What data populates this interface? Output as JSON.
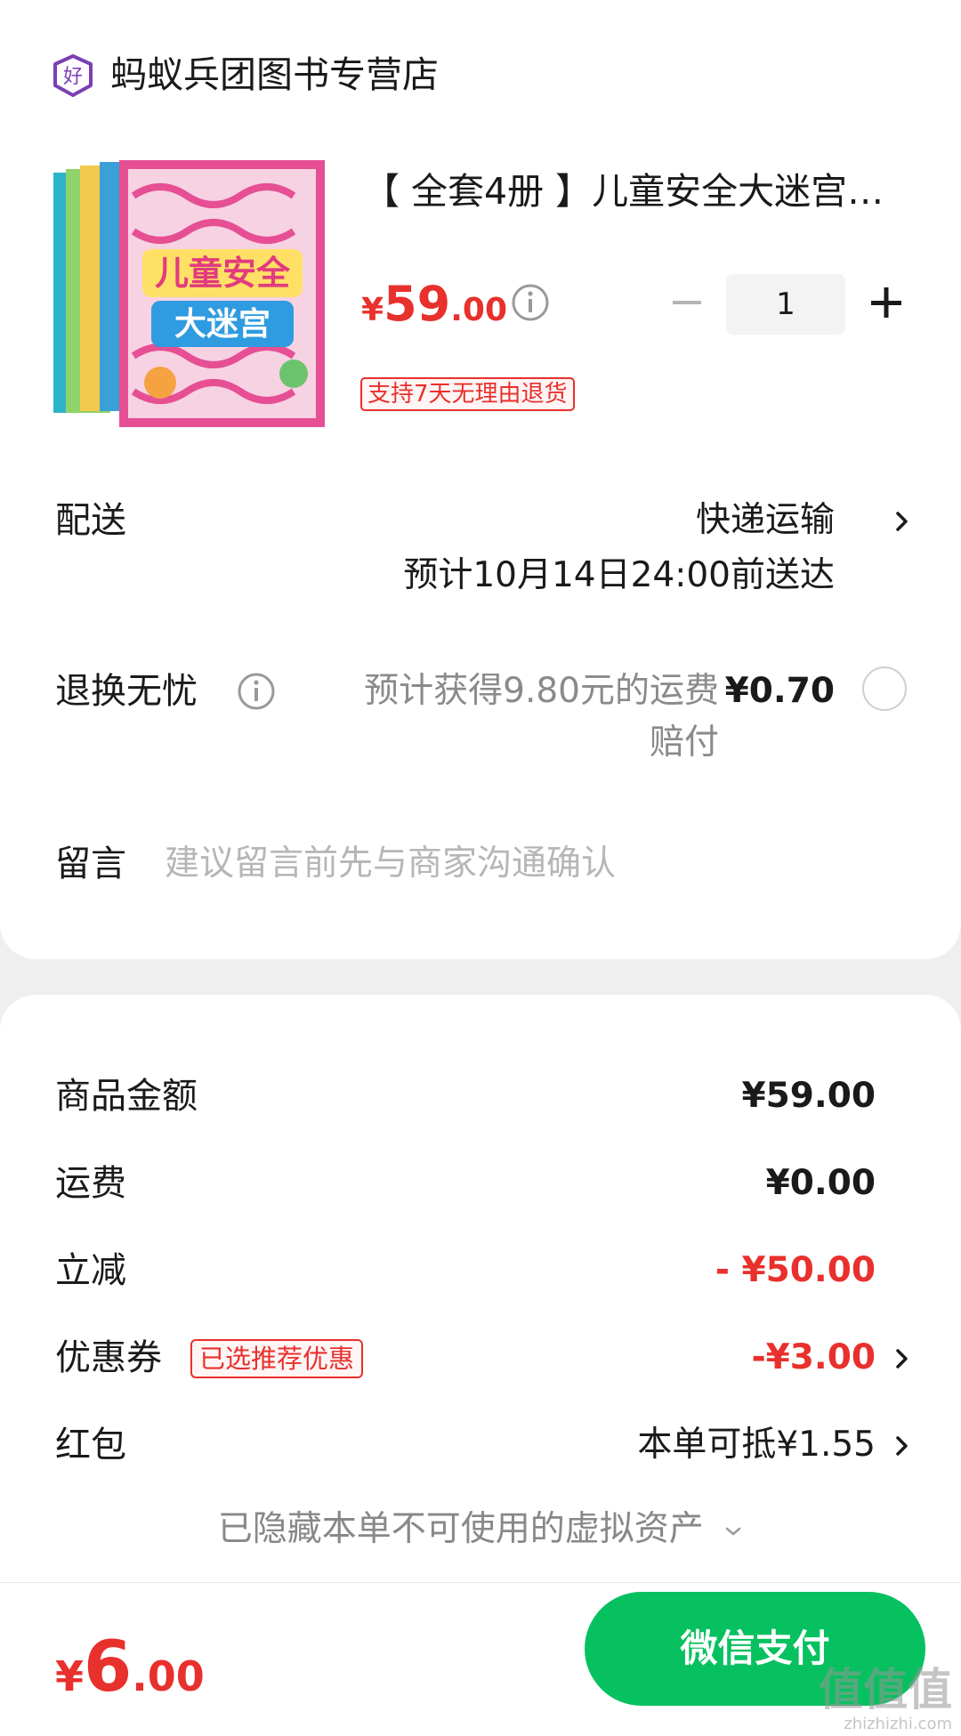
{
  "store": {
    "icon": "store-badge-icon",
    "badge_char": "好",
    "name": "蚂蚁兵团图书专营店"
  },
  "product": {
    "title": "【 全套4册 】儿童安全大迷宫…",
    "cover_text_line1": "儿童安全",
    "cover_text_line2": "大迷宫",
    "price_currency": "¥",
    "price_int": "59",
    "price_dec": ".00",
    "quantity": "1",
    "return_tag": "支持7天无理由退货"
  },
  "delivery": {
    "label": "配送",
    "method": "快递运输",
    "eta": "预计10月14日24:00前送达"
  },
  "return_insurance": {
    "label": "退换无忧",
    "desc_line1": "预计获得9.80元的运费",
    "desc_line2": "赔付",
    "price": "¥0.70"
  },
  "message": {
    "label": "留言",
    "placeholder": "建议留言前先与商家沟通确认"
  },
  "summary": {
    "goods_label": "商品金额",
    "goods_value": "¥59.00",
    "shipping_label": "运费",
    "shipping_value": "¥0.00",
    "discount_label": "立减",
    "discount_value": "- ¥50.00",
    "coupon_label": "优惠券",
    "coupon_tag": "已选推荐优惠",
    "coupon_value": "-¥3.00",
    "redpacket_label": "红包",
    "redpacket_value": "本单可抵¥1.55",
    "hidden_assets": "已隐藏本单不可使用的虚拟资产"
  },
  "footer": {
    "total_currency": "¥",
    "total_int": "6",
    "total_dec": ".00",
    "pay_label": "微信支付",
    "watermark_big": "值值值",
    "watermark_small": "zhizhizhi.com"
  },
  "colors": {
    "price_red": "#e8302c",
    "wechat_green": "#07c160",
    "store_purple": "#7b3fb5"
  }
}
